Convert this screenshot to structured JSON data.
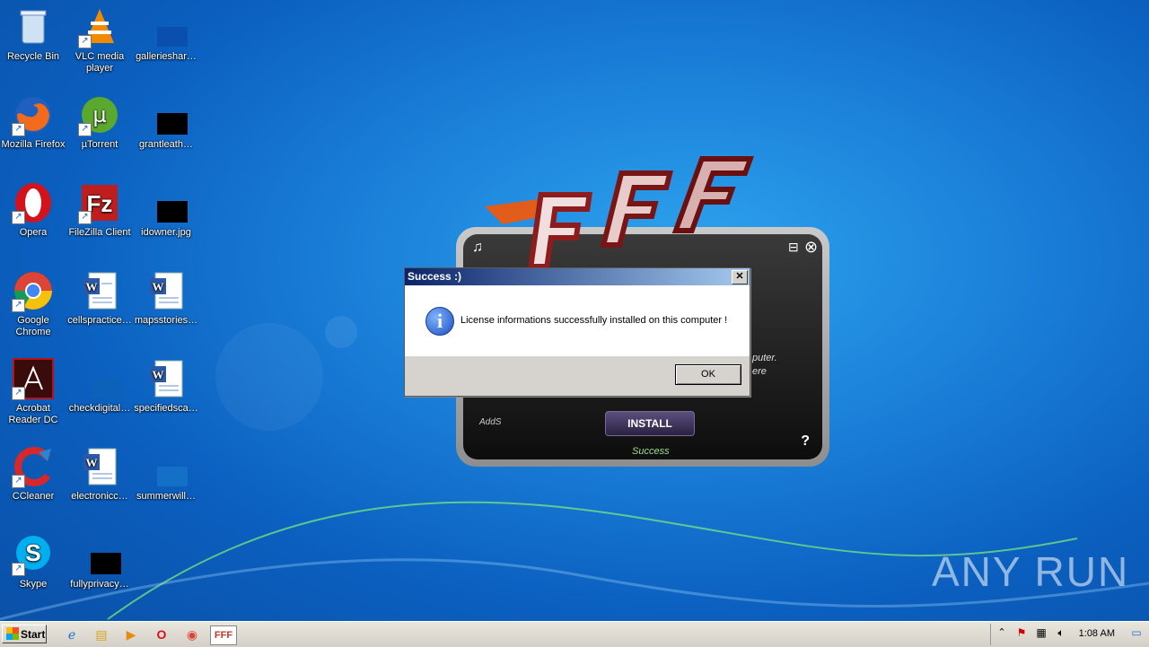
{
  "desktop": {
    "icons": [
      {
        "label": "Recycle Bin",
        "icon": "recycle-bin-icon"
      },
      {
        "label": "VLC media player",
        "icon": "vlc-icon"
      },
      {
        "label": "gallerieshar…",
        "icon": "file-icon"
      },
      {
        "label": "Mozilla Firefox",
        "icon": "firefox-icon"
      },
      {
        "label": "µTorrent",
        "icon": "utorrent-icon"
      },
      {
        "label": "grantleath…",
        "icon": "file-icon"
      },
      {
        "label": "Opera",
        "icon": "opera-icon"
      },
      {
        "label": "FileZilla Client",
        "icon": "filezilla-icon"
      },
      {
        "label": "idowner.jpg",
        "icon": "image-file-icon"
      },
      {
        "label": "Google Chrome",
        "icon": "chrome-icon"
      },
      {
        "label": "cellspractice…",
        "icon": "word-doc-icon"
      },
      {
        "label": "mapsstories…",
        "icon": "word-doc-icon"
      },
      {
        "label": "Acrobat Reader DC",
        "icon": "acrobat-icon"
      },
      {
        "label": "checkdigital…",
        "icon": "file-icon"
      },
      {
        "label": "specifiedsca…",
        "icon": "word-doc-icon"
      },
      {
        "label": "CCleaner",
        "icon": "ccleaner-icon"
      },
      {
        "label": "electronicc…",
        "icon": "word-doc-icon"
      },
      {
        "label": "summerwill…",
        "icon": "file-icon"
      },
      {
        "label": "Skype",
        "icon": "skype-icon"
      },
      {
        "label": "fullyprivacy…",
        "icon": "file-icon"
      }
    ],
    "watermark": "ANY RUN"
  },
  "installer": {
    "install_label": "INSTALL",
    "status": "Success",
    "help": "?",
    "side_text": "AddS",
    "partial_line_1": "puter.",
    "partial_line_2": "ere"
  },
  "dialog": {
    "title": "Success :)",
    "message": "License informations successfully installed on this computer !",
    "ok_label": "OK",
    "close_glyph": "✕"
  },
  "taskbar": {
    "start_label": "Start",
    "clock": "1:08 AM"
  },
  "colors": {
    "desktop_blue": "#1a7fd8",
    "titlebar": "#0a246a",
    "installer_button": "#3b3060"
  }
}
